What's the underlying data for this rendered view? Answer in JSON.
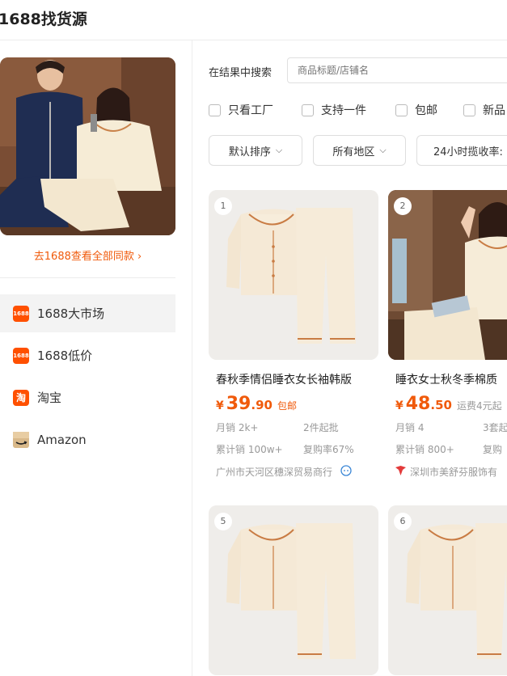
{
  "header": {
    "title": "1688找货源"
  },
  "sidebar": {
    "see_all": "去1688查看全部同款 ›",
    "items": [
      {
        "label": "1688大市场",
        "icon": "1688-market-icon",
        "icon_text": "1688",
        "color": "#ff5000",
        "active": true
      },
      {
        "label": "1688低价",
        "icon": "1688-lowprice-icon",
        "icon_text": "1688",
        "color": "#ff5000",
        "active": false
      },
      {
        "label": "淘宝",
        "icon": "taobao-icon",
        "icon_text": "淘",
        "color": "#ff5000",
        "active": false
      },
      {
        "label": "Amazon",
        "icon": "amazon-icon",
        "icon_text": "",
        "color": "#d9b98a",
        "active": false
      }
    ]
  },
  "search": {
    "label": "在结果中搜索",
    "placeholder": "商品标题/店铺名"
  },
  "filters": [
    "只看工厂",
    "支持一件",
    "包邮",
    "新品"
  ],
  "sorts": [
    "默认排序",
    "所有地区",
    "24小时揽收率:"
  ],
  "products": [
    {
      "rank": "1",
      "title": "春秋季情侣睡衣女长袖韩版",
      "price_symbol": "¥",
      "price_int": "39",
      "price_dec": ".90",
      "shipping": "包邮",
      "monthly_sales": "月销 2k+",
      "moq": "2件起批",
      "total_sales": "累计销 100w+",
      "repurchase": "复购率67%",
      "shop": "广州市天河区穗深贸易商行",
      "shop_icon": "verified-shop-icon"
    },
    {
      "rank": "2",
      "title": "睡衣女士秋冬季棉质",
      "price_symbol": "¥",
      "price_int": "48",
      "price_dec": ".50",
      "shipping": "运费4元起",
      "monthly_sales": "月销 4",
      "moq": "3套起",
      "total_sales": "累计销 800+",
      "repurchase": "复购",
      "shop": "深圳市美舒芬服饰有",
      "shop_icon": "factory-icon"
    },
    {
      "rank": "5"
    },
    {
      "rank": "6"
    }
  ],
  "colors": {
    "accent": "#f05a0b",
    "muted": "#999999"
  }
}
